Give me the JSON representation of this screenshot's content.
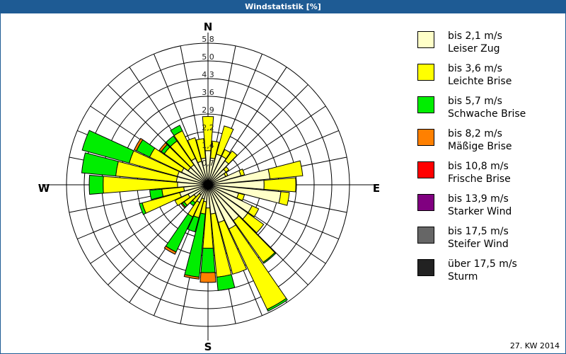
{
  "window": {
    "title": "Windstatistik [%]"
  },
  "footer": {
    "period": "27. KW 2014"
  },
  "chart_data": {
    "type": "wind-rose",
    "title": "Windstatistik [%]",
    "unit": "%",
    "compass_labels": {
      "N": "N",
      "E": "E",
      "S": "S",
      "W": "W"
    },
    "radial_ticks": [
      "0,7",
      "1,4",
      "2,2",
      "2,9",
      "3,6",
      "4,3",
      "5,0",
      "5,8"
    ],
    "radial_tick_values": [
      0.725,
      1.45,
      2.175,
      2.9,
      3.625,
      4.35,
      5.075,
      5.8
    ],
    "rmax": 5.8,
    "directions_deg": [
      0,
      10,
      20,
      30,
      40,
      50,
      60,
      70,
      80,
      90,
      100,
      110,
      120,
      130,
      140,
      150,
      160,
      170,
      180,
      190,
      200,
      210,
      220,
      230,
      240,
      250,
      260,
      270,
      280,
      290,
      300,
      310,
      320,
      330,
      340,
      350
    ],
    "series": [
      {
        "name": "bis 2,1 m/s",
        "desc": "Leiser Zug",
        "color": "#ffffc8",
        "values": [
          1.4,
          1.1,
          1.3,
          1.3,
          1.2,
          0.9,
          0.8,
          1.4,
          2.55,
          2.3,
          3.0,
          1.3,
          2.0,
          2.0,
          1.8,
          2.0,
          1.6,
          1.2,
          0.95,
          0.7,
          0.6,
          0.8,
          0.5,
          0.7,
          0.9,
          1.2,
          1.0,
          1.25,
          1.3,
          1.3,
          1.2,
          1.0,
          1.0,
          1.2,
          1.0,
          1.1
        ]
      },
      {
        "name": "bis 3,6 m/s",
        "desc": "Leichte Brise",
        "color": "#ffff00",
        "values": [
          1.4,
          0.7,
          1.2,
          0.3,
          0.5,
          0.15,
          0.1,
          0.15,
          1.35,
          1.3,
          0.35,
          0.25,
          0.3,
          0.8,
          2.1,
          3.65,
          2.2,
          2.6,
          1.65,
          0.5,
          0.8,
          0.65,
          0.4,
          0.5,
          0.6,
          1.6,
          0.9,
          3.05,
          2.5,
          2.05,
          1.45,
          1.2,
          1.2,
          1.25,
          1.0,
          0.8
        ]
      },
      {
        "name": "bis 5,7 m/s",
        "desc": "Schwache Brise",
        "color": "#00ee00",
        "values": [
          0,
          0,
          0,
          0,
          0,
          0,
          0,
          0,
          0,
          0,
          0,
          0,
          0,
          0,
          0.05,
          0.08,
          0,
          0.55,
          1.0,
          2.6,
          0.6,
          1.6,
          0.15,
          0.1,
          0,
          0.12,
          0.5,
          0.57,
          1.4,
          2.0,
          0.6,
          0.15,
          0.25,
          0.25,
          0,
          0
        ]
      },
      {
        "name": "bis 8,2 m/s",
        "desc": "Mäßige Brise",
        "color": "#ff8000",
        "values": [
          0,
          0,
          0,
          0,
          0,
          0,
          0,
          0,
          0,
          0,
          0,
          0,
          0,
          0,
          0,
          0,
          0,
          0,
          0.4,
          0.08,
          0,
          0.1,
          0,
          0.05,
          0,
          0,
          0,
          0,
          0,
          0,
          0.1,
          0.1,
          0,
          0,
          0,
          0
        ]
      },
      {
        "name": "bis 10,8 m/s",
        "desc": "Frische Brise",
        "color": "#ff0000",
        "values": [
          0,
          0,
          0,
          0,
          0,
          0,
          0,
          0,
          0,
          0,
          0,
          0,
          0,
          0,
          0,
          0,
          0,
          0,
          0,
          0,
          0,
          0,
          0,
          0,
          0,
          0,
          0,
          0,
          0,
          0,
          0,
          0,
          0,
          0,
          0,
          0
        ]
      },
      {
        "name": "bis 13,9 m/s",
        "desc": "Starker Wind",
        "color": "#800080",
        "values": [
          0,
          0,
          0,
          0,
          0,
          0,
          0,
          0,
          0,
          0,
          0,
          0,
          0,
          0,
          0,
          0,
          0,
          0,
          0,
          0,
          0,
          0,
          0,
          0,
          0,
          0,
          0,
          0,
          0,
          0,
          0,
          0,
          0,
          0,
          0,
          0
        ]
      },
      {
        "name": "bis 17,5 m/s",
        "desc": "Steifer Wind",
        "color": "#666666",
        "values": [
          0,
          0,
          0,
          0,
          0,
          0,
          0,
          0,
          0,
          0,
          0,
          0,
          0,
          0,
          0,
          0,
          0,
          0,
          0,
          0,
          0,
          0,
          0,
          0,
          0,
          0,
          0,
          0,
          0,
          0,
          0,
          0,
          0,
          0,
          0,
          0
        ]
      },
      {
        "name": "über 17,5 m/s",
        "desc": "Sturm",
        "color": "#222222",
        "values": [
          0,
          0,
          0,
          0,
          0,
          0,
          0,
          0,
          0,
          0,
          0,
          0,
          0,
          0,
          0,
          0,
          0,
          0,
          0,
          0,
          0,
          0,
          0,
          0,
          0,
          0,
          0,
          0,
          0,
          0,
          0,
          0,
          0,
          0,
          0,
          0
        ]
      }
    ],
    "legend_position": "right",
    "grid": true
  }
}
